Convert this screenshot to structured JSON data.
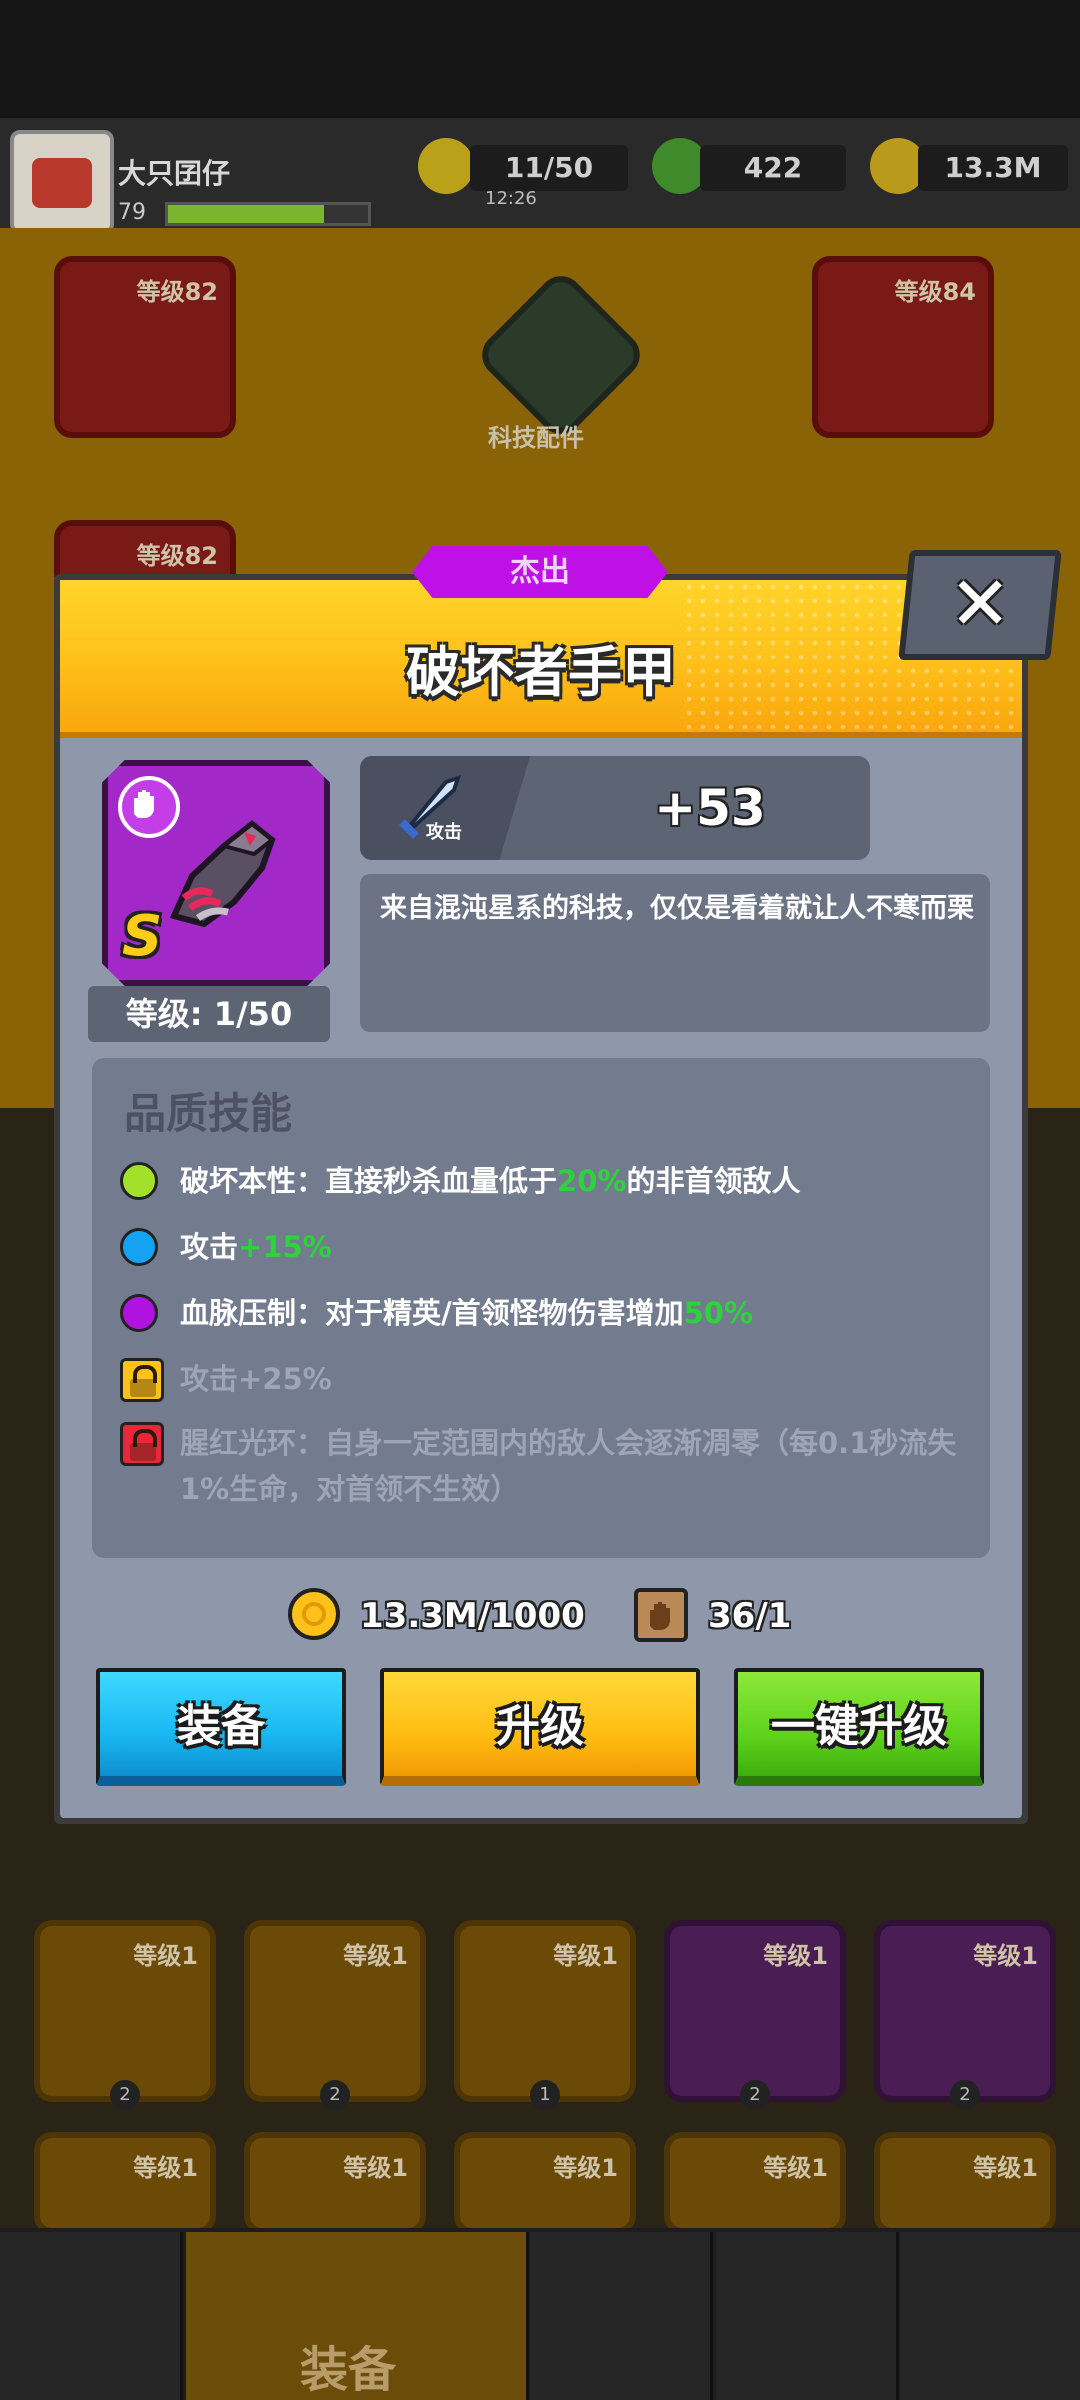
{
  "player": {
    "name": "大只囝仔",
    "level": "79",
    "badge": "52"
  },
  "resources": {
    "energy": "11/50",
    "energy_timer": "12:26",
    "gems": "422",
    "gold": "13.3M"
  },
  "background": {
    "tech_label": "科技配件",
    "top_slots": [
      "等级82",
      "等级84",
      "等级82"
    ],
    "row_slots": [
      "等级1",
      "等级1",
      "等级1",
      "等级1",
      "等级1"
    ],
    "row_counts": [
      "2",
      "2",
      "1",
      "2",
      "2"
    ],
    "bottom_slots": [
      "等级1",
      "等级1",
      "等级1",
      "等级1",
      "等级1"
    ],
    "grade": "S",
    "nav_active_label": "装备"
  },
  "modal": {
    "rarity": "杰出",
    "title": "破坏者手甲",
    "close_label": "✕",
    "item_grade": "S",
    "item_level": "等级: 1/50",
    "stat": {
      "label": "攻击",
      "value": "+53"
    },
    "description": "来自混沌星系的科技，仅仅是看着就让人不寒而栗",
    "skills_title": "品质技能",
    "skills": [
      {
        "prefix": "破坏本性：直接秒杀血量低于",
        "highlight": "20%",
        "suffix": "的非首领敌人",
        "color": "#a2e02a",
        "locked": false
      },
      {
        "prefix": "攻击",
        "highlight": "+15%",
        "suffix": "",
        "color": "#16a2f2",
        "locked": false
      },
      {
        "prefix": "血脉压制：对于精英/首领怪物伤害增加",
        "highlight": "50%",
        "suffix": "",
        "color": "#b012e0",
        "locked": false
      },
      {
        "prefix": "攻击+25%",
        "highlight": "",
        "suffix": "",
        "color": "#ffc21a",
        "locked": true
      },
      {
        "prefix": "腥红光环：自身一定范围内的敌人会逐渐凋零（每0.1秒流失1%生命，对首领不生效）",
        "highlight": "",
        "suffix": "",
        "color": "#e8283a",
        "locked": true
      }
    ],
    "cost": {
      "gold": "13.3M/1000",
      "material": "36/1"
    },
    "buttons": {
      "equip": "装备",
      "upgrade": "升级",
      "upgrade_all": "一键升级"
    }
  }
}
